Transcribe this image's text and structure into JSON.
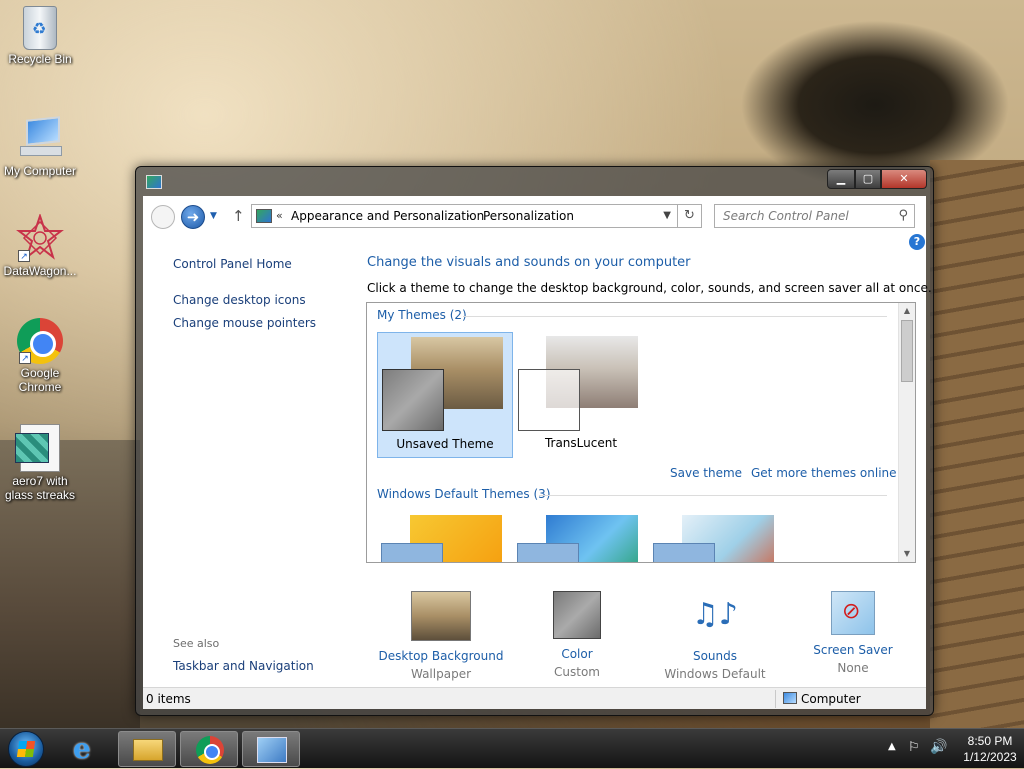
{
  "desktop": {
    "icons": [
      {
        "label": "Recycle Bin"
      },
      {
        "label": "My Computer"
      },
      {
        "label": "DataWagon..."
      },
      {
        "label": "Google Chrome"
      },
      {
        "label": "aero7 with glass streaks"
      }
    ]
  },
  "window": {
    "buttons": {
      "minimize": "▁",
      "maximize": "▢",
      "close": "✕"
    },
    "address": {
      "sep": "«",
      "crumbs": [
        "Appearance and Personalization",
        "Personalization"
      ],
      "crumb_sep": "›"
    },
    "search": {
      "placeholder": "Search Control Panel"
    },
    "left_pane": {
      "home": "Control Panel Home",
      "links": [
        "Change desktop icons",
        "Change mouse pointers"
      ],
      "see_also": "See also",
      "see_also_links": [
        "Taskbar and Navigation"
      ]
    },
    "heading": "Change the visuals and sounds on your computer",
    "subheading": "Click a theme to change the desktop background, color, sounds, and screen saver all at once.",
    "themes": {
      "my_themes_title": "My Themes (2)",
      "my_themes": [
        {
          "name": "Unsaved Theme",
          "selected": true
        },
        {
          "name": "TransLucent",
          "selected": false
        }
      ],
      "save_theme": "Save theme",
      "get_more": "Get more themes online",
      "default_title": "Windows Default Themes (3)"
    },
    "strip": [
      {
        "name": "Desktop Background",
        "value": "Wallpaper",
        "icon": "wallpaper-thumbnail-icon"
      },
      {
        "name": "Color",
        "value": "Custom",
        "icon": "color-swatch-icon"
      },
      {
        "name": "Sounds",
        "value": "Windows Default",
        "icon": "music-notes-icon"
      },
      {
        "name": "Screen Saver",
        "value": "None",
        "icon": "screen-saver-icon"
      }
    ],
    "status": {
      "items": "0 items",
      "location": "Computer"
    }
  },
  "taskbar": {
    "time": "8:50 PM",
    "date": "1/12/2023"
  },
  "colors": {
    "link": "#1d5ea8",
    "selection": "#cde4fb"
  }
}
